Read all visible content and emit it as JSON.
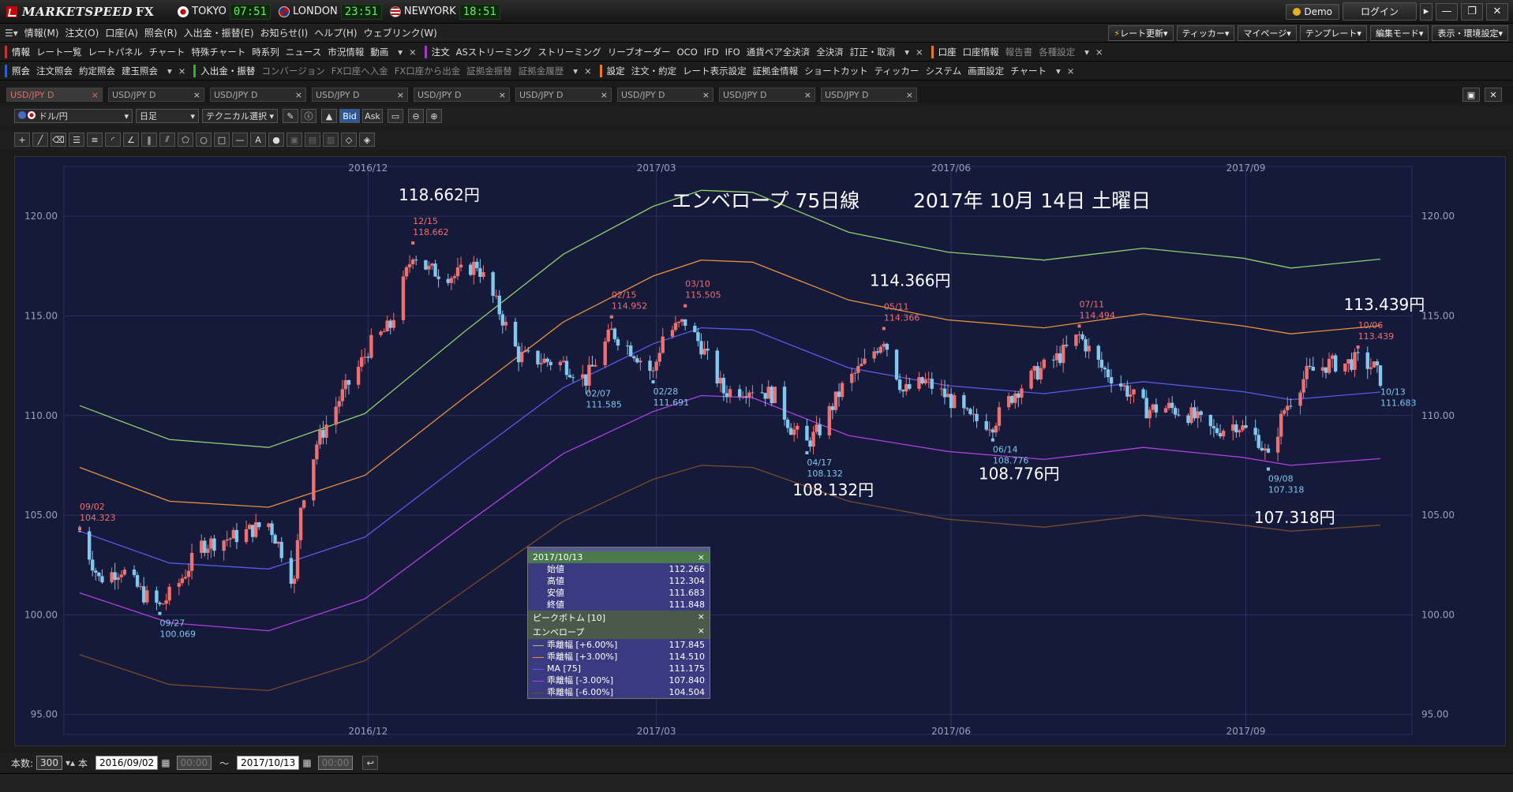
{
  "app": {
    "logo": "MARKETSPEED",
    "logo_fx": "FX"
  },
  "clocks": [
    {
      "city": "TOKYO",
      "time": "07:51"
    },
    {
      "city": "LONDON",
      "time": "23:51"
    },
    {
      "city": "NEWYORK",
      "time": "18:51"
    }
  ],
  "titlebar": {
    "demo": "Demo",
    "login": "ログイン"
  },
  "menu": [
    "情報(M)",
    "注文(O)",
    "口座(A)",
    "照会(R)",
    "入出金・振替(E)",
    "お知らせ(I)",
    "ヘルプ(H)",
    "ウェブリンク(W)"
  ],
  "menu_right": [
    "レート更新▾",
    "ティッカー▾",
    "マイページ▾",
    "テンプレート▾",
    "編集モード▾",
    "表示・環境設定▾"
  ],
  "toolbar1": {
    "info": {
      "label": "情報",
      "items": [
        "レート一覧",
        "レートパネル",
        "チャート",
        "特殊チャート",
        "時系列",
        "ニュース",
        "市況情報",
        "動画"
      ]
    },
    "order": {
      "label": "注文",
      "items": [
        "ASストリーミング",
        "ストリーミング",
        "リーブオーダー",
        "OCO",
        "IFD",
        "IFO",
        "通貨ペア全決済",
        "全決済",
        "訂正・取消"
      ]
    },
    "account": {
      "label": "口座",
      "items": [
        "口座情報"
      ],
      "dim_items": [
        "報告書",
        "各種設定"
      ]
    }
  },
  "toolbar2": {
    "inquiry": {
      "label": "照会",
      "items": [
        "注文照会",
        "約定照会",
        "建玉照会"
      ]
    },
    "transfer": {
      "label": "入出金・振替",
      "dim_items": [
        "コンバージョン",
        "FX口座へ入金",
        "FX口座から出金",
        "証拠金振替",
        "証拠金履歴"
      ]
    },
    "settings": {
      "label": "設定",
      "items": [
        "注文・約定",
        "レート表示設定",
        "証拠金情報",
        "ショートカット",
        "ティッカー",
        "システム",
        "画面設定",
        "チャート"
      ]
    }
  },
  "tabs": [
    "USD/JPY D",
    "USD/JPY D",
    "USD/JPY D",
    "USD/JPY D",
    "USD/JPY D",
    "USD/JPY D",
    "USD/JPY D",
    "USD/JPY D",
    "USD/JPY D"
  ],
  "chart_tools": {
    "pair": "ドル/円",
    "period": "日足",
    "technical": "テクニカル選択",
    "bid": "Bid",
    "ask": "Ask"
  },
  "bottom": {
    "count_label": "本数:",
    "count": "300",
    "count_unit": "本",
    "from_date": "2016/09/02",
    "time_placeholder": "00:00",
    "tilde": "〜",
    "to_date": "2017/10/13"
  },
  "info_panel": {
    "date": "2017/10/13",
    "ohlc": [
      {
        "label": "始値",
        "value": "112.266"
      },
      {
        "label": "高値",
        "value": "112.304"
      },
      {
        "label": "安値",
        "value": "111.683"
      },
      {
        "label": "終値",
        "value": "111.848"
      }
    ],
    "groups": [
      "ピークボトム [10]",
      "エンベロープ"
    ],
    "indicators": [
      {
        "label": "乖離幅 [+6.00%]",
        "value": "117.845",
        "color": "#8fd16a"
      },
      {
        "label": "乖離幅 [+3.00%]",
        "value": "114.510",
        "color": "#e8923a"
      },
      {
        "label": "MA [75]",
        "value": "111.175",
        "color": "#5a5ae8"
      },
      {
        "label": "乖離幅 [-3.00%]",
        "value": "107.840",
        "color": "#b040e0"
      },
      {
        "label": "乖離幅 [-6.00%]",
        "value": "104.504",
        "color": "#7a4a2a"
      }
    ]
  },
  "chart_data": {
    "type": "candlestick",
    "title": "エンベロープ 75日線",
    "date_title": "2017年 10月 14日 土曜日",
    "x_range": [
      "2016-09-02",
      "2017-10-13"
    ],
    "ylim": [
      94,
      122.5
    ],
    "yticks": [
      "95.00",
      "100.00",
      "105.00",
      "110.00",
      "115.00",
      "120.00"
    ],
    "xticks": [
      {
        "date": "2016-12-01",
        "label": "2016/12"
      },
      {
        "date": "2017-03-01",
        "label": "2017/03"
      },
      {
        "date": "2017-06-01",
        "label": "2017/06"
      },
      {
        "date": "2017-09-01",
        "label": "2017/09"
      }
    ],
    "colors": {
      "up": "#f07070",
      "down": "#80c8ee",
      "high_label": "#f07070",
      "low_label": "#80c8ee"
    },
    "peaks": [
      {
        "date": "2016-09-02",
        "date_label": "09/02",
        "price": "104.323",
        "type": "high"
      },
      {
        "date": "2016-12-15",
        "date_label": "12/15",
        "price": "118.662",
        "type": "high"
      },
      {
        "date": "2017-02-15",
        "date_label": "02/15",
        "price": "114.952",
        "type": "high"
      },
      {
        "date": "2017-03-10",
        "date_label": "03/10",
        "price": "115.505",
        "type": "high"
      },
      {
        "date": "2017-05-11",
        "date_label": "05/11",
        "price": "114.366",
        "type": "high"
      },
      {
        "date": "2017-07-11",
        "date_label": "07/11",
        "price": "114.494",
        "type": "high"
      },
      {
        "date": "2017-10-06",
        "date_label": "10/06",
        "price": "113.439",
        "type": "high"
      },
      {
        "date": "2016-09-27",
        "date_label": "09/27",
        "price": "100.069",
        "type": "low"
      },
      {
        "date": "2017-02-07",
        "date_label": "02/07",
        "price": "111.585",
        "type": "low"
      },
      {
        "date": "2017-02-28",
        "date_label": "02/28",
        "price": "111.691",
        "type": "low"
      },
      {
        "date": "2017-04-17",
        "date_label": "04/17",
        "price": "108.132",
        "type": "low"
      },
      {
        "date": "2017-06-14",
        "date_label": "06/14",
        "price": "108.776",
        "type": "low"
      },
      {
        "date": "2017-09-08",
        "date_label": "09/08",
        "price": "107.318",
        "type": "low"
      },
      {
        "date": "2017-10-13",
        "date_label": "10/13",
        "price": "111.683",
        "type": "low"
      }
    ],
    "annotations": [
      {
        "text": "118.662円",
        "date": "2016-12-15",
        "price": 120.8
      },
      {
        "text": "114.366円",
        "date": "2017-05-11",
        "price": 116.5
      },
      {
        "text": "113.439円",
        "date": "2017-10-06",
        "price": 115.3
      },
      {
        "text": "108.132円",
        "date": "2017-04-17",
        "price": 106.0
      },
      {
        "text": "108.776円",
        "date": "2017-06-14",
        "price": 106.8
      },
      {
        "text": "107.318円",
        "date": "2017-09-08",
        "price": 104.6
      }
    ],
    "price_path": [
      [
        "2016-09-02",
        104.2
      ],
      [
        "2016-09-08",
        101.8
      ],
      [
        "2016-09-15",
        102.3
      ],
      [
        "2016-09-22",
        101.0
      ],
      [
        "2016-09-27",
        100.4
      ],
      [
        "2016-10-03",
        101.6
      ],
      [
        "2016-10-10",
        103.5
      ],
      [
        "2016-10-20",
        103.9
      ],
      [
        "2016-10-31",
        104.6
      ],
      [
        "2016-11-04",
        103.2
      ],
      [
        "2016-11-08",
        101.6
      ],
      [
        "2016-11-10",
        105.5
      ],
      [
        "2016-11-15",
        108.6
      ],
      [
        "2016-11-22",
        110.8
      ],
      [
        "2016-11-28",
        112.4
      ],
      [
        "2016-12-02",
        113.6
      ],
      [
        "2016-12-08",
        114.5
      ],
      [
        "2016-12-15",
        118.2
      ],
      [
        "2016-12-20",
        117.3
      ],
      [
        "2016-12-28",
        117.0
      ],
      [
        "2017-01-04",
        117.6
      ],
      [
        "2017-01-10",
        115.6
      ],
      [
        "2017-01-17",
        113.0
      ],
      [
        "2017-01-23",
        112.8
      ],
      [
        "2017-01-31",
        112.6
      ],
      [
        "2017-02-07",
        111.8
      ],
      [
        "2017-02-15",
        114.2
      ],
      [
        "2017-02-22",
        113.2
      ],
      [
        "2017-02-28",
        112.1
      ],
      [
        "2017-03-03",
        114.0
      ],
      [
        "2017-03-10",
        114.7
      ],
      [
        "2017-03-15",
        113.5
      ],
      [
        "2017-03-22",
        111.2
      ],
      [
        "2017-03-31",
        111.4
      ],
      [
        "2017-04-07",
        111.0
      ],
      [
        "2017-04-12",
        109.4
      ],
      [
        "2017-04-17",
        108.6
      ],
      [
        "2017-04-21",
        109.3
      ],
      [
        "2017-04-28",
        111.4
      ],
      [
        "2017-05-05",
        112.6
      ],
      [
        "2017-05-11",
        113.9
      ],
      [
        "2017-05-17",
        111.2
      ],
      [
        "2017-05-24",
        111.7
      ],
      [
        "2017-05-31",
        110.9
      ],
      [
        "2017-06-07",
        109.8
      ],
      [
        "2017-06-14",
        109.6
      ],
      [
        "2017-06-21",
        111.2
      ],
      [
        "2017-06-28",
        112.2
      ],
      [
        "2017-07-05",
        113.0
      ],
      [
        "2017-07-11",
        114.0
      ],
      [
        "2017-07-18",
        112.4
      ],
      [
        "2017-07-25",
        111.4
      ],
      [
        "2017-08-01",
        110.3
      ],
      [
        "2017-08-08",
        110.4
      ],
      [
        "2017-08-15",
        110.0
      ],
      [
        "2017-08-22",
        109.2
      ],
      [
        "2017-08-29",
        109.6
      ],
      [
        "2017-09-05",
        108.8
      ],
      [
        "2017-09-08",
        107.8
      ],
      [
        "2017-09-13",
        110.3
      ],
      [
        "2017-09-20",
        112.1
      ],
      [
        "2017-09-27",
        112.6
      ],
      [
        "2017-10-02",
        112.6
      ],
      [
        "2017-10-06",
        112.8
      ],
      [
        "2017-10-11",
        112.4
      ],
      [
        "2017-10-13",
        111.85
      ]
    ],
    "envelopes": {
      "ma75": [
        [
          "2016-09-02",
          104.2
        ],
        [
          "2016-09-30",
          102.6
        ],
        [
          "2016-10-31",
          102.3
        ],
        [
          "2016-11-30",
          103.9
        ],
        [
          "2016-12-31",
          107.7
        ],
        [
          "2017-01-31",
          111.4
        ],
        [
          "2017-02-28",
          113.6
        ],
        [
          "2017-03-15",
          114.4
        ],
        [
          "2017-03-31",
          114.3
        ],
        [
          "2017-04-30",
          112.4
        ],
        [
          "2017-05-31",
          111.5
        ],
        [
          "2017-06-30",
          111.1
        ],
        [
          "2017-07-31",
          111.7
        ],
        [
          "2017-08-31",
          111.2
        ],
        [
          "2017-09-15",
          110.8
        ],
        [
          "2017-10-13",
          111.18
        ]
      ],
      "plus6": [
        [
          "2016-09-02",
          110.5
        ],
        [
          "2016-09-30",
          108.8
        ],
        [
          "2016-10-31",
          108.4
        ],
        [
          "2016-11-30",
          110.1
        ],
        [
          "2016-12-31",
          114.2
        ],
        [
          "2017-01-31",
          118.1
        ],
        [
          "2017-02-28",
          120.5
        ],
        [
          "2017-03-15",
          121.3
        ],
        [
          "2017-03-31",
          121.2
        ],
        [
          "2017-04-30",
          119.2
        ],
        [
          "2017-05-31",
          118.2
        ],
        [
          "2017-06-30",
          117.8
        ],
        [
          "2017-07-31",
          118.4
        ],
        [
          "2017-08-31",
          117.9
        ],
        [
          "2017-09-15",
          117.4
        ],
        [
          "2017-10-13",
          117.85
        ]
      ],
      "plus3": [
        [
          "2016-09-02",
          107.4
        ],
        [
          "2016-09-30",
          105.7
        ],
        [
          "2016-10-31",
          105.4
        ],
        [
          "2016-11-30",
          107.0
        ],
        [
          "2016-12-31",
          110.9
        ],
        [
          "2017-01-31",
          114.7
        ],
        [
          "2017-02-28",
          117.0
        ],
        [
          "2017-03-15",
          117.8
        ],
        [
          "2017-03-31",
          117.7
        ],
        [
          "2017-04-30",
          115.8
        ],
        [
          "2017-05-31",
          114.8
        ],
        [
          "2017-06-30",
          114.4
        ],
        [
          "2017-07-31",
          115.1
        ],
        [
          "2017-08-31",
          114.5
        ],
        [
          "2017-09-15",
          114.1
        ],
        [
          "2017-10-13",
          114.51
        ]
      ],
      "minus3": [
        [
          "2016-09-02",
          101.1
        ],
        [
          "2016-09-30",
          99.6
        ],
        [
          "2016-10-31",
          99.2
        ],
        [
          "2016-11-30",
          100.8
        ],
        [
          "2016-12-31",
          104.5
        ],
        [
          "2017-01-31",
          108.1
        ],
        [
          "2017-02-28",
          110.2
        ],
        [
          "2017-03-15",
          111.0
        ],
        [
          "2017-03-31",
          110.9
        ],
        [
          "2017-04-30",
          109.0
        ],
        [
          "2017-05-31",
          108.2
        ],
        [
          "2017-06-30",
          107.8
        ],
        [
          "2017-07-31",
          108.4
        ],
        [
          "2017-08-31",
          107.9
        ],
        [
          "2017-09-15",
          107.5
        ],
        [
          "2017-10-13",
          107.84
        ]
      ],
      "minus6": [
        [
          "2016-09-02",
          98.0
        ],
        [
          "2016-09-30",
          96.5
        ],
        [
          "2016-10-31",
          96.2
        ],
        [
          "2016-11-30",
          97.7
        ],
        [
          "2016-12-31",
          101.2
        ],
        [
          "2017-01-31",
          104.7
        ],
        [
          "2017-02-28",
          106.8
        ],
        [
          "2017-03-15",
          107.5
        ],
        [
          "2017-03-31",
          107.4
        ],
        [
          "2017-04-30",
          105.7
        ],
        [
          "2017-05-31",
          104.8
        ],
        [
          "2017-06-30",
          104.4
        ],
        [
          "2017-07-31",
          105.0
        ],
        [
          "2017-08-31",
          104.5
        ],
        [
          "2017-09-15",
          104.2
        ],
        [
          "2017-10-13",
          104.5
        ]
      ]
    }
  }
}
